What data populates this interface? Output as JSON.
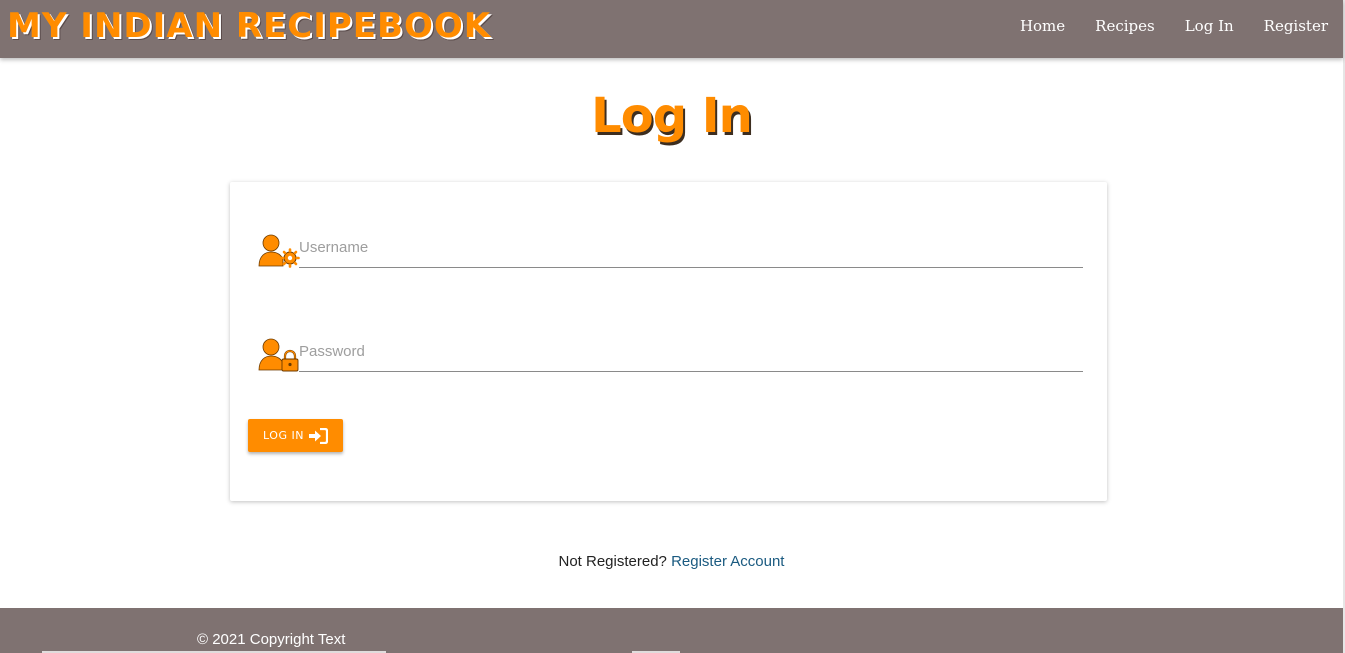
{
  "brand": {
    "title": "My Indian RecipeBook"
  },
  "nav": {
    "items": [
      {
        "label": "Home"
      },
      {
        "label": "Recipes"
      },
      {
        "label": "Log In"
      },
      {
        "label": "Register"
      }
    ]
  },
  "page": {
    "title": "Log In"
  },
  "form": {
    "username": {
      "placeholder": "Username",
      "value": "",
      "icon": "user-cog-icon"
    },
    "password": {
      "placeholder": "Password",
      "value": "",
      "icon": "user-lock-icon"
    },
    "submit": {
      "label": "LOG IN",
      "icon": "sign-in-icon"
    }
  },
  "register": {
    "prompt": "Not Registered?",
    "link_label": "Register Account"
  },
  "footer": {
    "copyright": "© 2021 Copyright Text"
  },
  "colors": {
    "accent": "#ff8c00",
    "navbar": "#7f7271",
    "link": "#1a5a80"
  }
}
